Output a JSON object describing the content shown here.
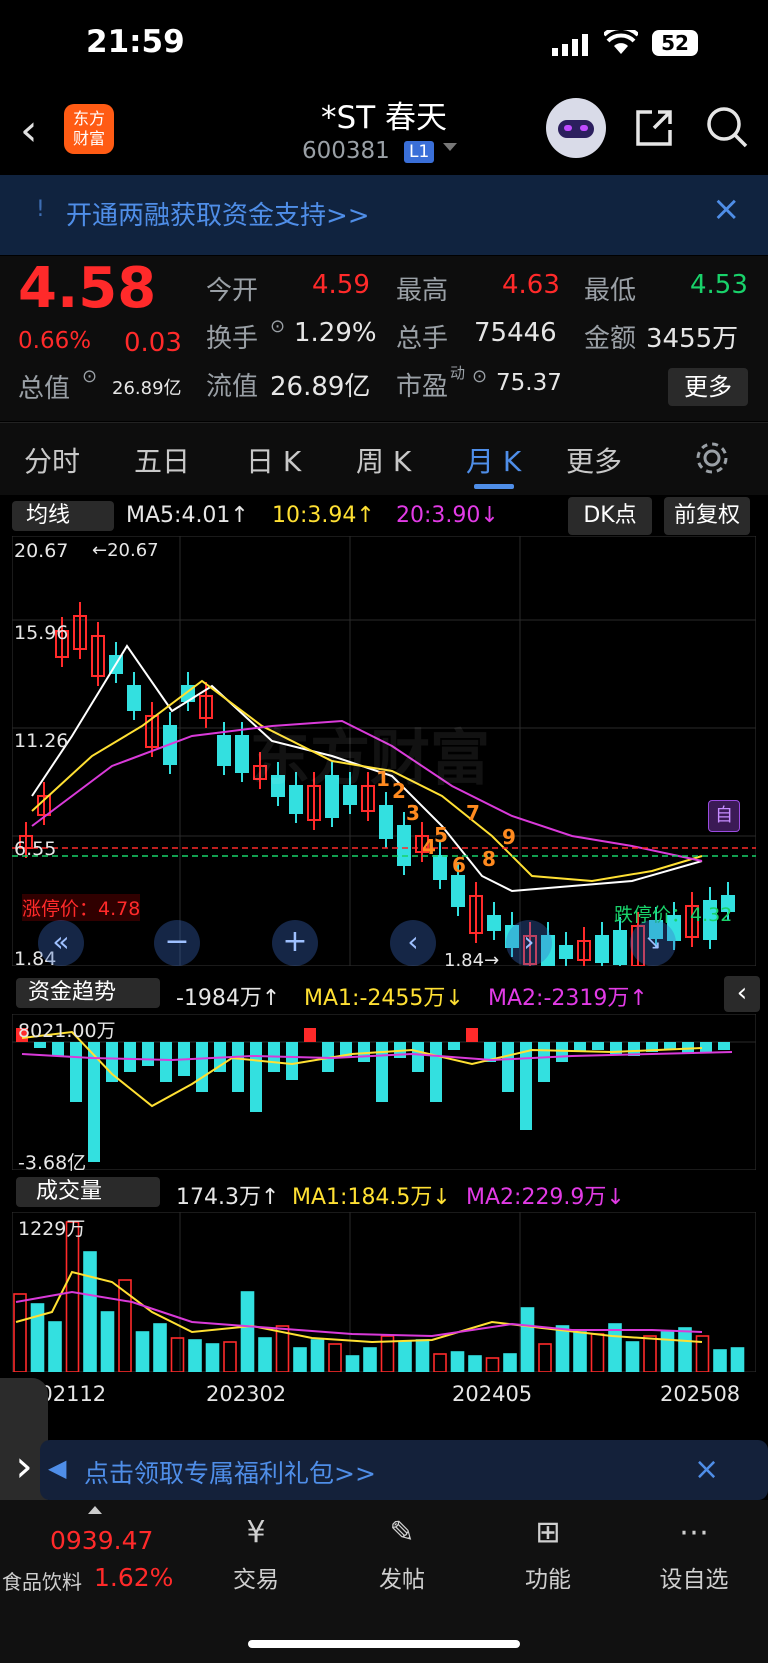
{
  "status": {
    "time": "21:59",
    "battery": "52"
  },
  "header": {
    "title": "*ST 春天",
    "code": "600381",
    "badge": "L1"
  },
  "banner": {
    "text": "开通两融获取资金支持>>"
  },
  "quote": {
    "price": "4.58",
    "change_pct": "0.66%",
    "change": "0.03",
    "open_label": "今开",
    "open": "4.59",
    "high_label": "最高",
    "high": "4.63",
    "low_label": "最低",
    "low": "4.53",
    "turnover_label": "换手",
    "turnover": "1.29%",
    "volume_label": "总手",
    "volume": "75446",
    "amount_label": "金额",
    "amount": "3455万",
    "mcap_label": "总值",
    "mcap": "26.89亿",
    "float_label": "流值",
    "float": "26.89亿",
    "pe_label": "市盈",
    "pe_sup": "动",
    "pe": "75.37",
    "more": "更多"
  },
  "tabs": [
    "分时",
    "五日",
    "日 K",
    "周 K",
    "月 K",
    "更多"
  ],
  "ma_bar": {
    "selector": "均线",
    "ma5": "MA5:4.01↑",
    "ma10": "10:3.94↑",
    "ma20": "20:3.90↓",
    "dk": "DK点",
    "adjust": "前复权"
  },
  "kline": {
    "y_ticks": [
      "20.67",
      "15.96",
      "11.26",
      "6.55",
      "1.84"
    ],
    "max_marker": "←20.67",
    "min_marker": "1.84→",
    "limit_up": "涨停价：4.78",
    "limit_down": "跌停价：4.32",
    "self_tag": "自",
    "watermark": "东方财富",
    "signals": [
      "1",
      "2",
      "3",
      "4",
      "5",
      "6",
      "7",
      "8",
      "9"
    ]
  },
  "fund": {
    "selector": "资金趋势",
    "value": "-1984万↑",
    "ma1": "MA1:-2455万↓",
    "ma2": "MA2:-2319万↑",
    "top": "8021.00万",
    "bottom": "-3.68亿"
  },
  "vol": {
    "selector": "成交量",
    "value": "174.3万↑",
    "ma1": "MA1:184.5万↓",
    "ma2": "MA2:229.9万↓",
    "top": "1229万",
    "x_labels": [
      "202112",
      "202302",
      "202405",
      "202508"
    ]
  },
  "promo": {
    "text": "点击领取专属福利礼包>>"
  },
  "bottom": {
    "index_value": "0939.47",
    "index_name": "食品饮料",
    "index_pct": "1.62%",
    "nav": [
      "交易",
      "发帖",
      "功能",
      "设自选"
    ]
  },
  "colors": {
    "up": "#ff2a2a",
    "down": "#19d26a",
    "cyan": "#33e0e0",
    "ma_white": "#ffffff",
    "ma_yellow": "#ffe033",
    "ma_magenta": "#d93ad9"
  }
}
